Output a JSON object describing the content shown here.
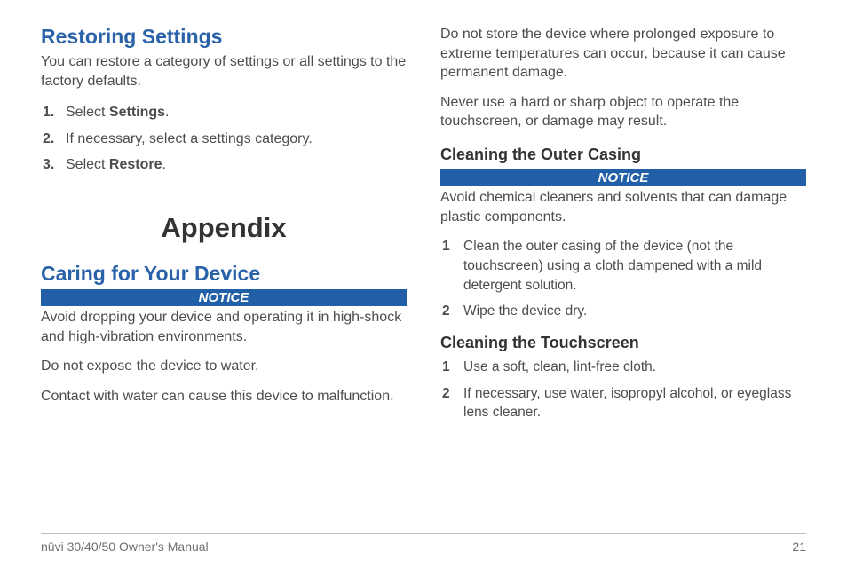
{
  "left": {
    "h1": "Restoring Settings",
    "intro": "You can restore a category of settings or all settings to the factory defaults.",
    "steps": {
      "s1a": "Select ",
      "s1b": "Settings",
      "s1c": ".",
      "s2": "If necessary, select a settings category.",
      "s3a": "Select ",
      "s3b": "Restore",
      "s3c": "."
    },
    "h2": "Appendix",
    "h3": "Caring for Your Device",
    "notice": "NOTICE",
    "p1": "Avoid dropping your device and operating it in high-shock and high-vibration environments.",
    "p2": "Do not expose the device to water.",
    "p3": "Contact with water can cause this device to malfunction."
  },
  "right": {
    "p1": "Do not store the device where prolonged exposure to extreme temperatures can occur, because it can cause permanent damage.",
    "p2": "Never use a hard or sharp object to operate the touchscreen, or damage may result.",
    "h1": "Cleaning the Outer Casing",
    "notice": "NOTICE",
    "p3": "Avoid chemical cleaners and solvents that can damage plastic components.",
    "steps1": {
      "s1": "Clean the outer casing of the device (not the touchscreen) using a cloth dampened with a mild detergent solution.",
      "s2": "Wipe the device dry."
    },
    "h2": "Cleaning the Touchscreen",
    "steps2": {
      "s1": "Use a soft, clean, lint-free cloth.",
      "s2": "If necessary, use water, isopropyl alcohol, or eyeglass lens cleaner."
    }
  },
  "footer": {
    "left": "nüvi 30/40/50 Owner's Manual",
    "right": "21"
  }
}
